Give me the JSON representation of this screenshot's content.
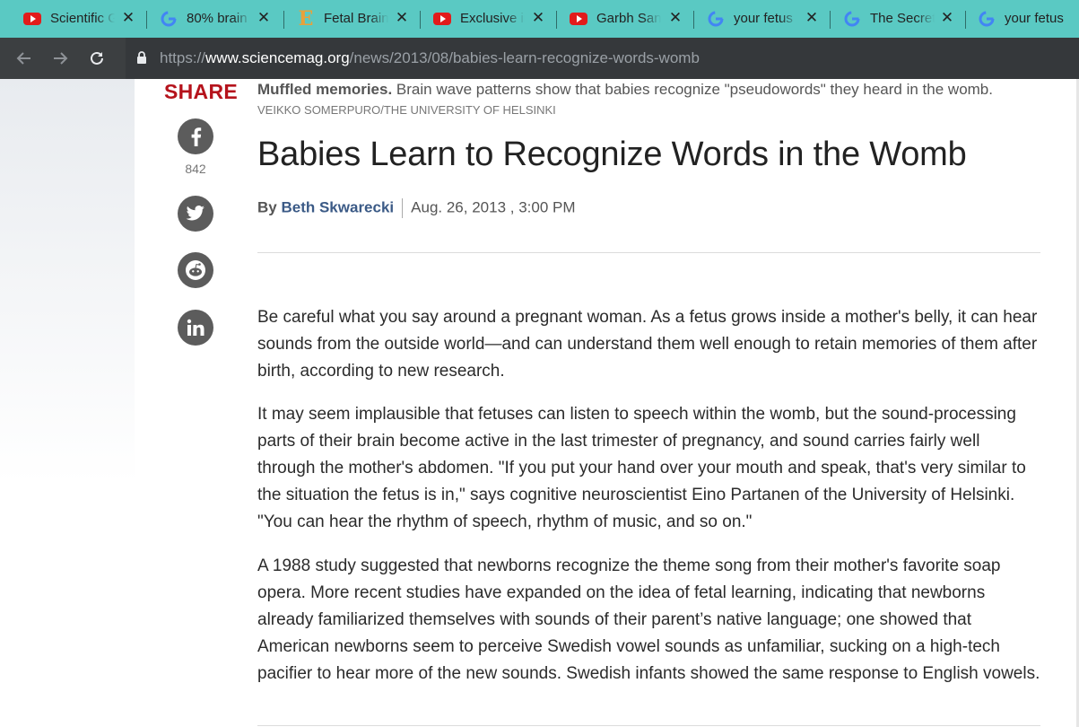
{
  "tabs": [
    {
      "favicon": "youtube-icon",
      "title": "Scientific G"
    },
    {
      "favicon": "google-icon",
      "title": "80% brain"
    },
    {
      "favicon": "e-letter-icon",
      "title": "Fetal Brain"
    },
    {
      "favicon": "youtube-icon",
      "title": "Exclusive in"
    },
    {
      "favicon": "youtube-icon",
      "title": "Garbh Sans"
    },
    {
      "favicon": "google-icon",
      "title": "your fetus"
    },
    {
      "favicon": "google-icon",
      "title": "The Secret"
    },
    {
      "favicon": "google-icon",
      "title": "your fetus"
    }
  ],
  "toolbar": {
    "url_scheme": "https://",
    "url_host": "www.sciencemag.org",
    "url_path": "/news/2013/08/babies-learn-recognize-words-womb"
  },
  "share": {
    "label": "SHARE",
    "facebook_count": "842"
  },
  "article": {
    "caption_bold": "Muffled memories.",
    "caption_text": " Brain wave patterns show that babies recognize \"pseudowords\" they heard in the womb.",
    "credit": "VEIKKO SOMERPURO/THE UNIVERSITY OF HELSINKI",
    "headline": "Babies Learn to Recognize Words in the Womb",
    "by_label": "By",
    "author": "Beth Skwarecki",
    "date": "Aug. 26, 2013 , 3:00 PM",
    "paragraphs": [
      "Be careful what you say around a pregnant woman. As a fetus grows inside a mother's belly, it can hear sounds from the outside world—and can understand them well enough to retain memories of them after birth, according to new research.",
      "It may seem implausible that fetuses can listen to speech within the womb, but the sound-processing parts of their brain become active in the last trimester of pregnancy, and sound carries fairly well through the mother's abdomen. \"If you put your hand over your mouth and speak, that's very similar to the situation the fetus is in,\" says cognitive neuroscientist Eino Partanen of the University of Helsinki. \"You can hear the rhythm of speech, rhythm of music, and so on.\"",
      "A 1988 study suggested that newborns recognize the theme song from their mother's favorite soap opera. More recent studies have expanded on the idea of fetal learning, indicating that newborns already familiarized themselves with sounds of their parent’s native language; one showed that American newborns seem to perceive Swedish vowel sounds as unfamiliar, sucking on a high-tech pacifier to hear more of the new sounds. Swedish infants showed the same response to English vowels."
    ]
  },
  "colors": {
    "tabstrip": "#5ac9c3",
    "toolbar": "#3c3f41",
    "share_red": "#b5131c",
    "author_blue": "#3b5a86"
  }
}
